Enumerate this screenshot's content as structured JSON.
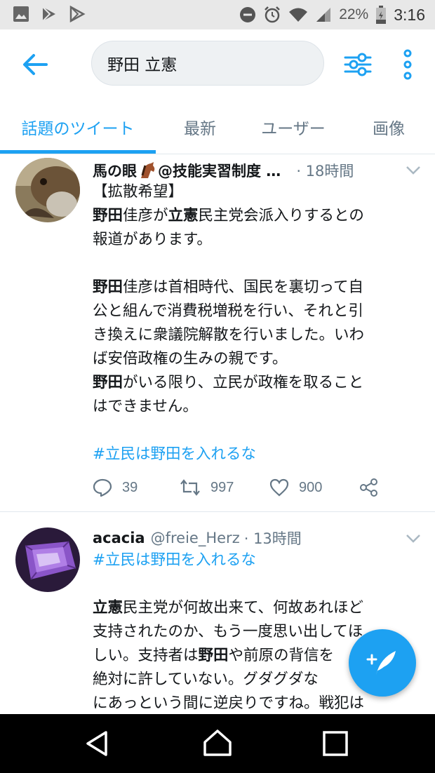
{
  "status_bar": {
    "battery_pct": "22%",
    "time": "3:16",
    "left_icons": [
      "gallery-icon",
      "play-store-icon",
      "play-store-icon"
    ],
    "right_icons": [
      "do-not-disturb-icon",
      "alarm-icon",
      "wifi-icon",
      "signal-icon",
      "battery-icon"
    ]
  },
  "search": {
    "query": "野田 立憲"
  },
  "tabs": [
    {
      "label": "話題のツイート",
      "active": true
    },
    {
      "label": "最新",
      "active": false
    },
    {
      "label": "ユーザー",
      "active": false
    },
    {
      "label": "画像",
      "active": false
    }
  ],
  "tweets": [
    {
      "name": "馬の眼",
      "name_suffix": "@技能実習制度 …",
      "time": "· 18時間",
      "lines": [
        "【拡散希望】",
        "野田佳彦が立憲民主党会派入りするとの",
        "報道があります。",
        "",
        "野田佳彦は首相時代、国民を裏切って自",
        "公と組んで消費税増税を行い、それと引",
        "き換えに衆議院解散を行いました。いわ",
        "ば安倍政権の生みの親です。",
        "野田がいる限り、立民が政権を取ること",
        "はできません。",
        "",
        "#立民は野田を入れるな"
      ],
      "replies": "39",
      "retweets": "997",
      "likes": "900"
    },
    {
      "name": "acacia",
      "handle": "@freie_Herz",
      "time": "· 13時間",
      "lines": [
        "#立民は野田を入れるな",
        "",
        "立憲民主党が何故出来て、何故あれほど",
        "支持されたのか、もう一度思い出してほ",
        "しい。支持者は野田や前原の背信を",
        "絶対に許していない。グダグダな",
        "にあっという間に逆戻りですね。戦犯は"
      ]
    }
  ],
  "colors": {
    "accent": "#1da1f2",
    "text": "#14171a",
    "secondary": "#657786"
  }
}
